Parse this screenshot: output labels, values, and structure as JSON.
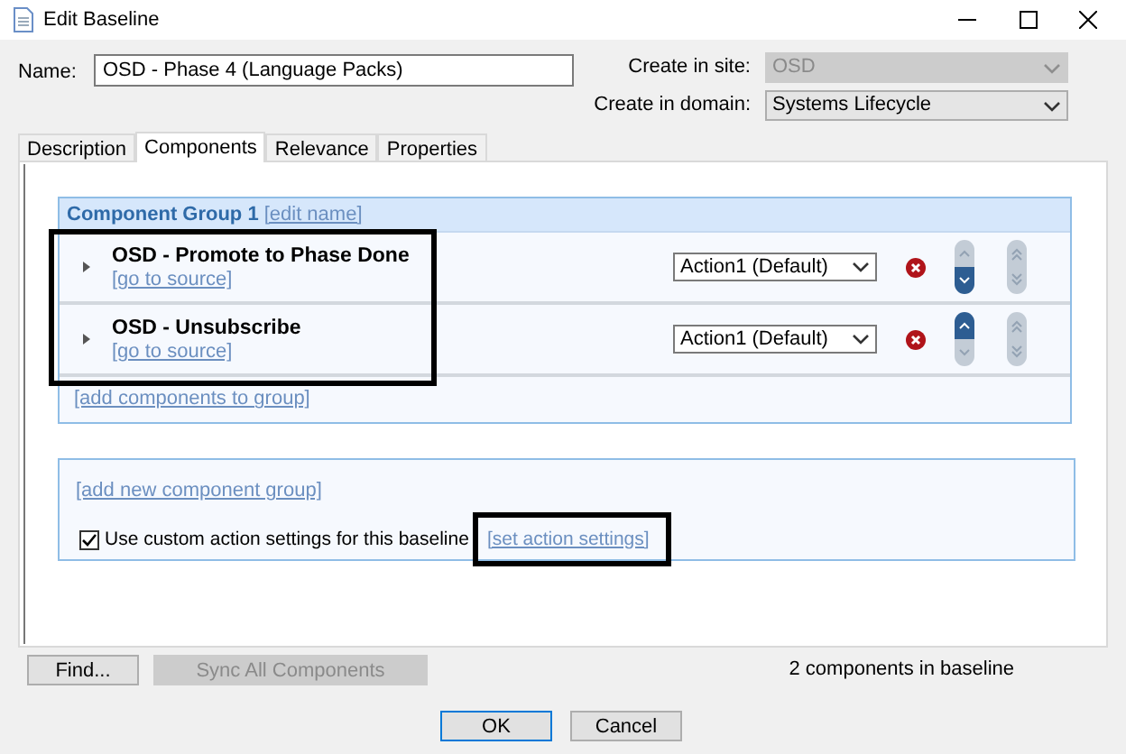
{
  "window": {
    "title": "Edit Baseline"
  },
  "name_field": {
    "label": "Name:",
    "value": "OSD - Phase 4 (Language Packs)"
  },
  "site": {
    "label": "Create in site:",
    "value": "OSD",
    "disabled": true
  },
  "domain": {
    "label": "Create in domain:",
    "value": "Systems Lifecycle",
    "disabled": false
  },
  "tabs": [
    {
      "label": "Description",
      "selected": false
    },
    {
      "label": "Components",
      "selected": true
    },
    {
      "label": "Relevance",
      "selected": false
    },
    {
      "label": "Properties",
      "selected": false
    }
  ],
  "group": {
    "title": "Component Group 1",
    "edit_link": "[edit name]",
    "add_link": "[add components to group]",
    "components": [
      {
        "name": "OSD - Promote to Phase Done",
        "link": "[go to source]",
        "action": "Action1 (Default)",
        "can_move_up": false,
        "can_move_down": true
      },
      {
        "name": "OSD - Unsubscribe",
        "link": "[go to source]",
        "action": "Action1 (Default)",
        "can_move_up": true,
        "can_move_down": false
      }
    ]
  },
  "add_group_link": "[add new component group]",
  "custom_actions": {
    "label": "Use custom action settings for this baseline",
    "checked": true,
    "link": "[set action settings]"
  },
  "find_button": {
    "label": "Find...",
    "disabled": false
  },
  "sync_button": {
    "label": "Sync All Components",
    "disabled": true
  },
  "status": "2 components in baseline",
  "buttons": [
    {
      "label": "OK",
      "default": true
    },
    {
      "label": "Cancel",
      "default": false
    }
  ]
}
